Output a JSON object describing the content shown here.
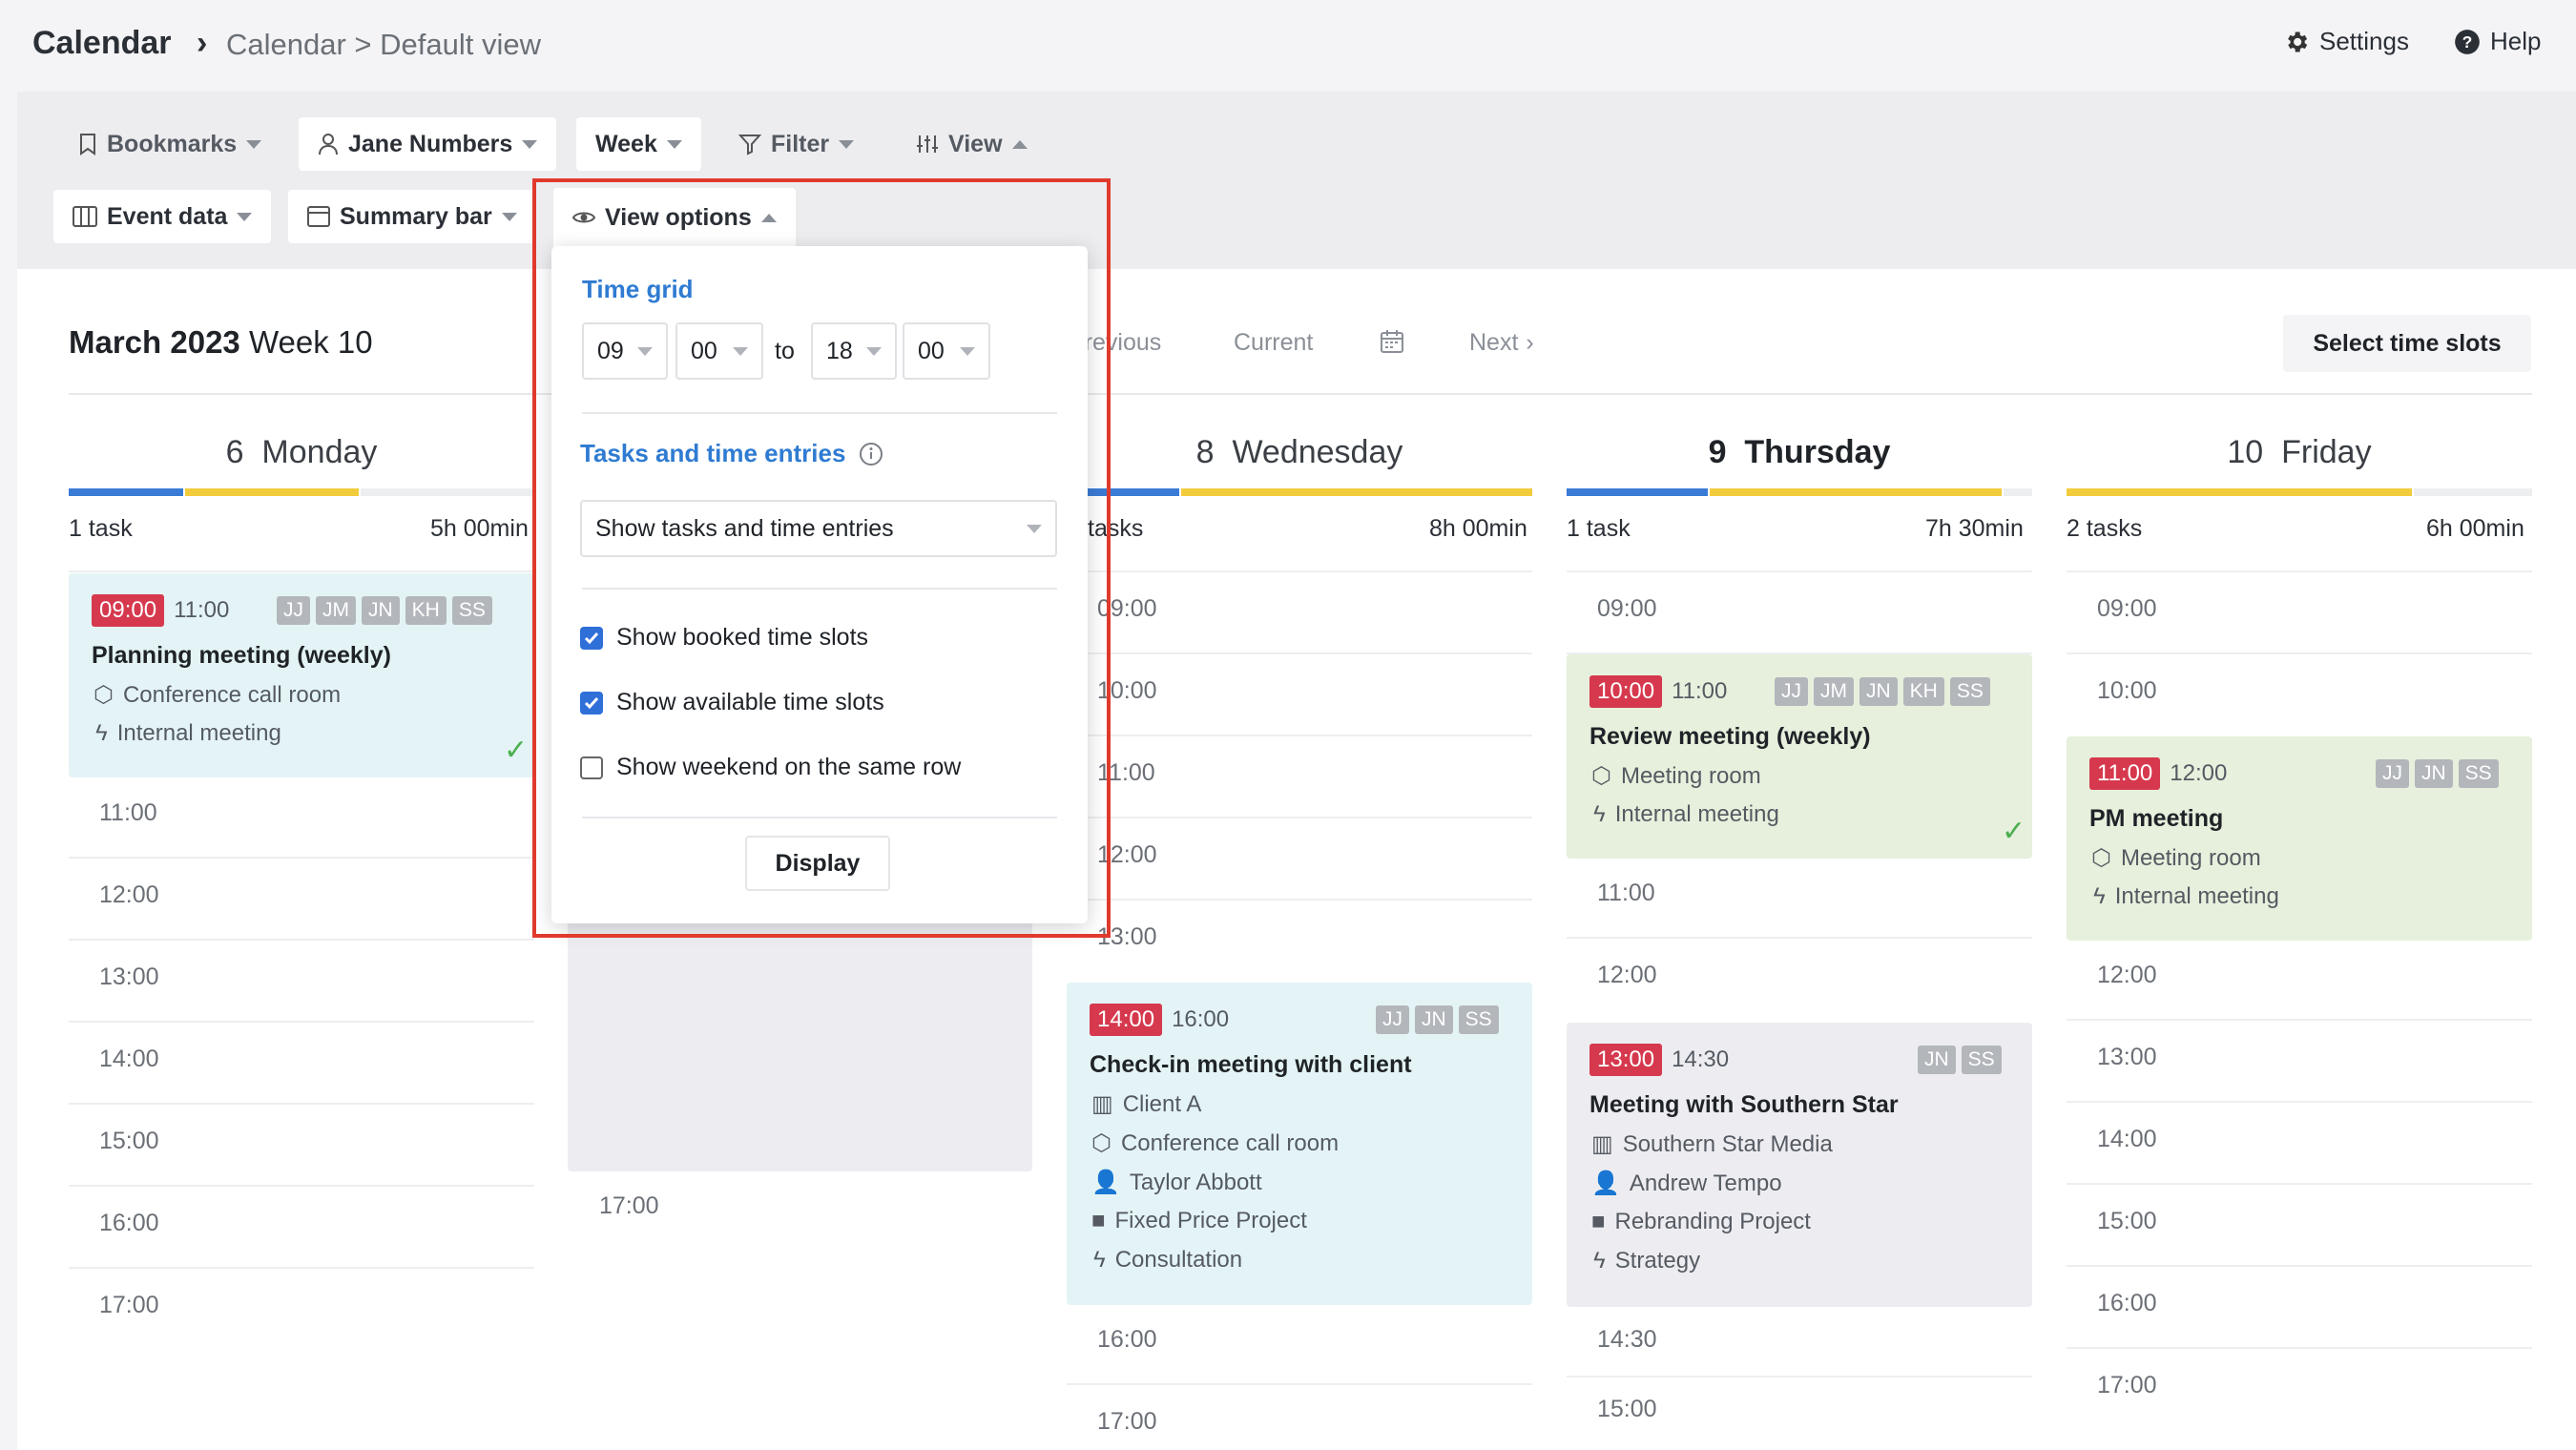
{
  "header": {
    "title": "Calendar",
    "separator": "›",
    "breadcrumb": "Calendar > Default view",
    "settings": "Settings",
    "help": "Help"
  },
  "toolbar": {
    "bookmarks": "Bookmarks",
    "user": "Jane Numbers",
    "period": "Week",
    "filter": "Filter",
    "view": "View",
    "event_data": "Event data",
    "summary_bar": "Summary bar",
    "view_options": "View options"
  },
  "week": {
    "month": "March 2023",
    "week_label": "Week 10",
    "previous": "Previous",
    "current": "Current",
    "next": "Next",
    "select_slots": "Select time slots"
  },
  "days": [
    {
      "num": "6",
      "name": "Monday",
      "tasks": "1 task",
      "hours": "5h 00min"
    },
    {
      "num": "8",
      "name": "Wednesday",
      "tasks": "tasks",
      "hours": "8h 00min"
    },
    {
      "num": "9",
      "name": "Thursday",
      "tasks": "1 task",
      "hours": "7h 30min"
    },
    {
      "num": "10",
      "name": "Friday",
      "tasks": "2 tasks",
      "hours": "6h 00min"
    }
  ],
  "times": {
    "mon": [
      "11:00",
      "12:00",
      "13:00",
      "14:00",
      "15:00",
      "16:00",
      "17:00"
    ],
    "tue": [
      "17:00"
    ],
    "wed": [
      "09:00",
      "10:00",
      "11:00",
      "12:00",
      "13:00",
      "16:00",
      "17:00"
    ],
    "thu": [
      "09:00",
      "11:00",
      "12:00",
      "14:30",
      "15:00"
    ],
    "fri": [
      "09:00",
      "10:00",
      "12:00",
      "13:00",
      "14:00",
      "15:00",
      "16:00",
      "17:00"
    ]
  },
  "events": {
    "planning": {
      "start": "09:00",
      "end": "11:00",
      "initials": [
        "JJ",
        "JM",
        "JN",
        "KH",
        "SS"
      ],
      "title": "Planning meeting (weekly)",
      "room": "Conference call room",
      "type": "Internal meeting"
    },
    "checkin": {
      "start": "14:00",
      "end": "16:00",
      "initials": [
        "JJ",
        "JN",
        "SS"
      ],
      "title": "Check-in meeting with client",
      "client": "Client A",
      "room": "Conference call room",
      "person": "Taylor Abbott",
      "project": "Fixed Price Project",
      "type": "Consultation"
    },
    "review": {
      "start": "10:00",
      "end": "11:00",
      "initials": [
        "JJ",
        "JM",
        "JN",
        "KH",
        "SS"
      ],
      "title": "Review meeting (weekly)",
      "room": "Meeting room",
      "type": "Internal meeting"
    },
    "southern": {
      "start": "13:00",
      "end": "14:30",
      "initials": [
        "JN",
        "SS"
      ],
      "title": "Meeting with Southern Star",
      "client": "Southern Star Media",
      "person": "Andrew Tempo",
      "project": "Rebranding Project",
      "type": "Strategy"
    },
    "pm": {
      "start": "11:00",
      "end": "12:00",
      "initials": [
        "JJ",
        "JN",
        "SS"
      ],
      "title": "PM meeting",
      "room": "Meeting room",
      "type": "Internal meeting"
    }
  },
  "popup": {
    "time_grid": "Time grid",
    "from_h": "09",
    "from_m": "00",
    "to": "to",
    "to_h": "18",
    "to_m": "00",
    "tasks_heading": "Tasks and time entries",
    "tasks_select": "Show tasks and time entries",
    "cb_booked": "Show booked time slots",
    "cb_available": "Show available time slots",
    "cb_weekend": "Show weekend on the same row",
    "display": "Display"
  },
  "colors": {
    "accent_red": "#d6394d",
    "blue": "#2f7bd2",
    "yellow": "#f2cc3d",
    "teal_event": "#e4f4f6",
    "green_event": "#e6f0dc",
    "grey_event": "#ededf1",
    "highlight": "#e03a2c"
  }
}
